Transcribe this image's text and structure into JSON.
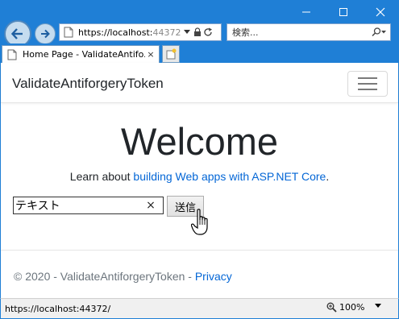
{
  "browser": {
    "address_url_host": "https://localhost:",
    "address_url_port": "44372",
    "search_placeholder": "検索...",
    "tab_title": "Home Page - ValidateAntifo...",
    "tab_close": "×",
    "status_url": "https://localhost:44372/",
    "zoom_level": "100%"
  },
  "site": {
    "brand": "ValidateAntiforgeryToken",
    "heading": "Welcome",
    "learn_prefix": "Learn about ",
    "learn_link": "building Web apps with ASP.NET Core",
    "learn_suffix": ".",
    "form": {
      "text_value": "テキスト",
      "clear_glyph": "×",
      "submit_label": "送信"
    },
    "footer_text": "© 2020 - ValidateAntiforgeryToken - ",
    "footer_link": "Privacy"
  },
  "colors": {
    "chrome_blue": "#1f7fd6",
    "link_blue": "#0366d6",
    "muted_text": "#6c757d"
  },
  "icons": [
    "minimize-icon",
    "maximize-icon",
    "close-icon",
    "back-arrow-icon",
    "forward-arrow-icon",
    "page-icon",
    "dropdown-icon",
    "refresh-icon",
    "search-icon",
    "new-tab-icon",
    "hamburger-icon",
    "hand-cursor-icon",
    "zoom-icon"
  ]
}
